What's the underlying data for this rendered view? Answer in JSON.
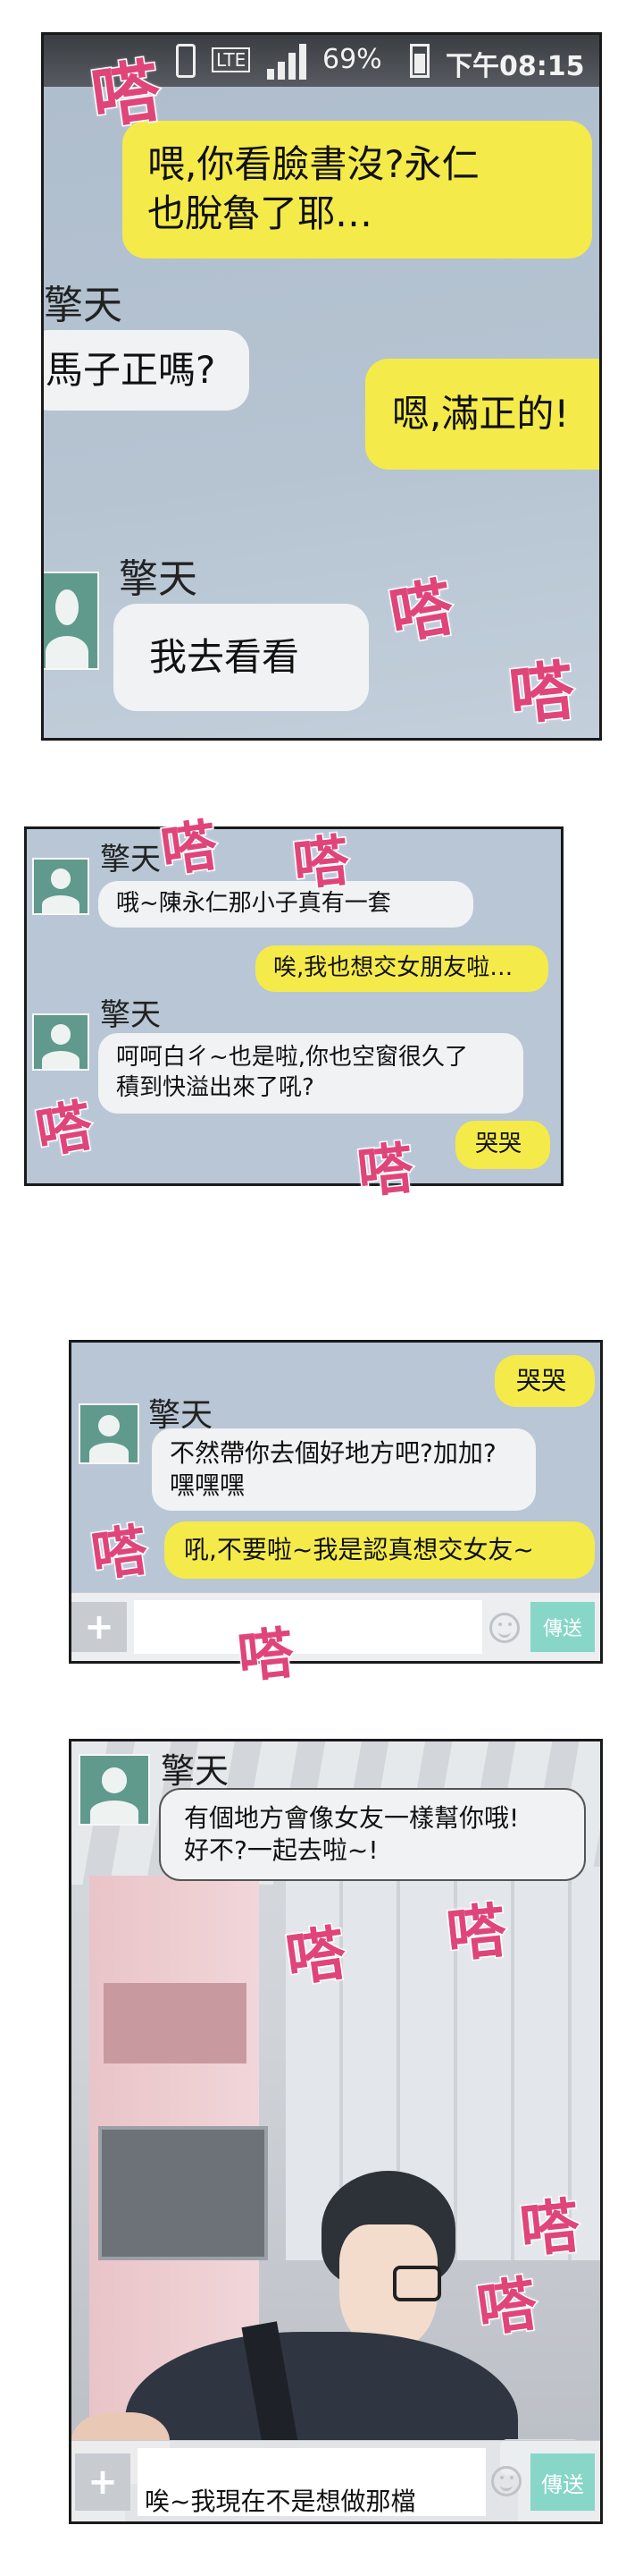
{
  "sfx": {
    "sound": "嗒"
  },
  "status_bar": {
    "lte": "LTE",
    "battery": "69%",
    "time": "下午08:15"
  },
  "contact": {
    "name": "擎天"
  },
  "panel1": {
    "messages": [
      {
        "side": "right",
        "text": "喂,你看臉書沒?永仁\n也脫魯了耶…"
      },
      {
        "side": "left",
        "text": "馬子正嗎?"
      },
      {
        "side": "right",
        "text": "嗯,滿正的!"
      },
      {
        "side": "left",
        "text": "我去看看"
      }
    ]
  },
  "panel2": {
    "messages": [
      {
        "side": "left",
        "text": "哦~陳永仁那小子真有一套"
      },
      {
        "side": "right",
        "text": "唉,我也想交女朋友啦…"
      },
      {
        "side": "left",
        "text": "呵呵白ㄔ~也是啦,你也空窗很久了\n積到快溢出來了吼?"
      },
      {
        "side": "right",
        "text": "哭哭"
      }
    ]
  },
  "panel3": {
    "messages": [
      {
        "side": "right",
        "text": "哭哭"
      },
      {
        "side": "left",
        "text": "不然帶你去個好地方吧?加加?\n嘿嘿嘿"
      },
      {
        "side": "right",
        "text": "吼,不要啦~我是認真想交女友~"
      }
    ],
    "input": {
      "send_label": "傳送"
    }
  },
  "panel4": {
    "messages": [
      {
        "side": "left",
        "text": "有個地方會像女友一樣幫你哦!\n好不?一起去啦~!"
      }
    ],
    "input": {
      "draft": "唉~我現在不是想做那檔\n事啦",
      "send_label": "傳送"
    }
  },
  "colors": {
    "chat_bg": "#b8c6d6",
    "yellow_bubble": "#f4ea4a",
    "white_bubble": "#f1f2f4",
    "sfx": "#e0457a",
    "send": "#87d6c7"
  }
}
